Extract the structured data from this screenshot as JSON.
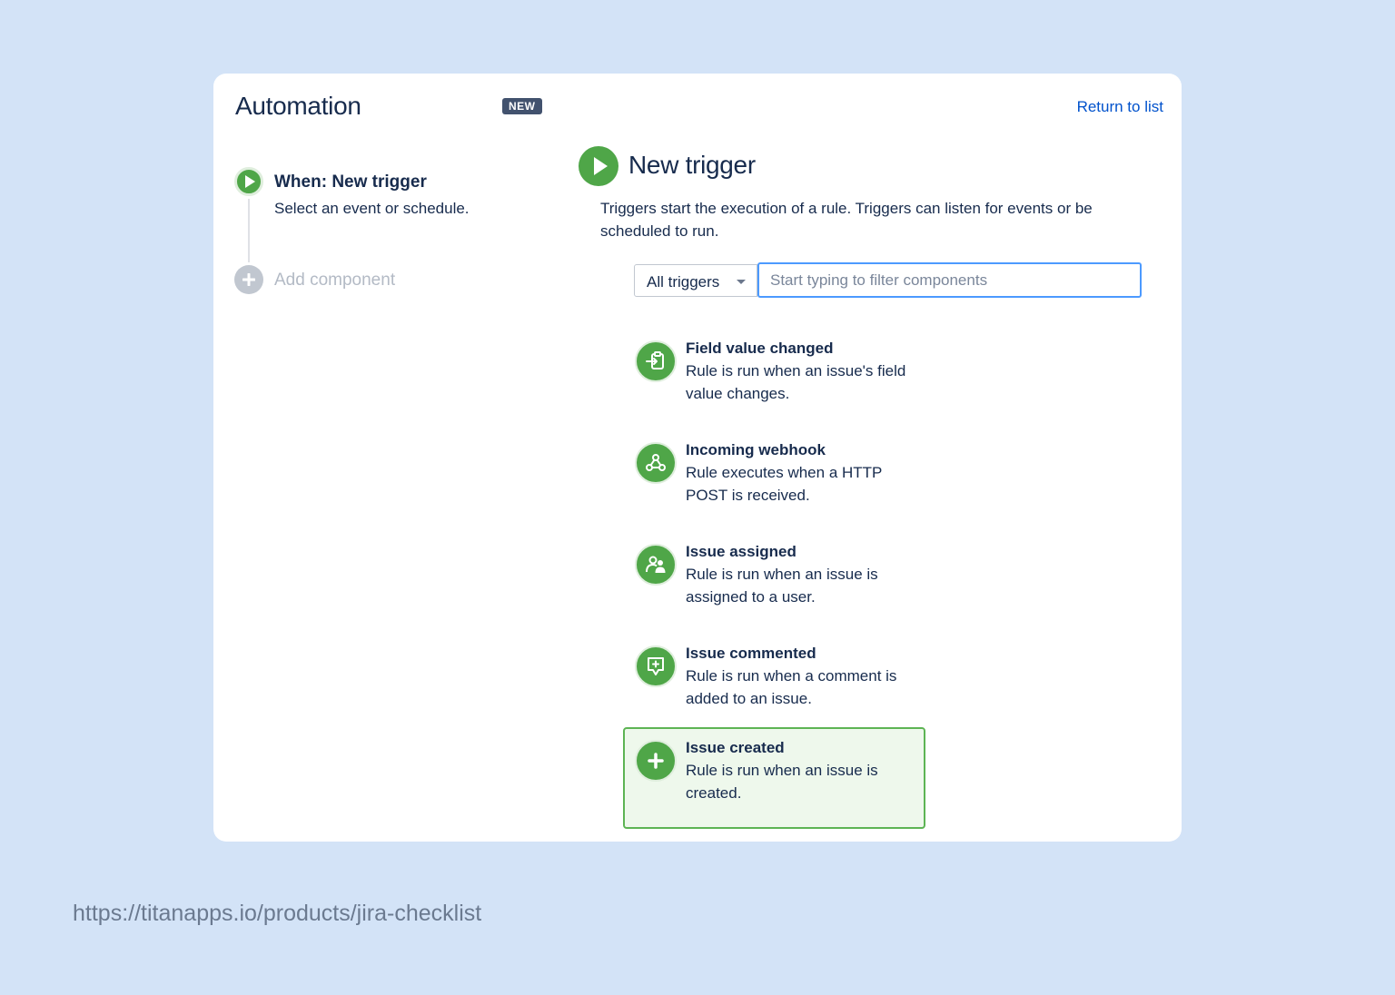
{
  "header": {
    "title": "Automation",
    "badge": "NEW",
    "return_link": "Return to list"
  },
  "rule_steps": {
    "when_title": "When: New trigger",
    "when_subtitle": "Select an event or schedule.",
    "add_component": "Add component"
  },
  "panel": {
    "title": "New trigger",
    "description": "Triggers start the execution of a rule. Triggers can listen for events or be scheduled to run."
  },
  "filter": {
    "select_value": "All triggers",
    "input_placeholder": "Start typing to filter components",
    "input_value": ""
  },
  "triggers": [
    {
      "title": "Field value changed",
      "description": "Rule is run when an issue's field value changes.",
      "icon": "field-change-icon",
      "selected": false
    },
    {
      "title": "Incoming webhook",
      "description": "Rule executes when a HTTP POST is received.",
      "icon": "webhook-icon",
      "selected": false
    },
    {
      "title": "Issue assigned",
      "description": "Rule is run when an issue is assigned to a user.",
      "icon": "user-assign-icon",
      "selected": false
    },
    {
      "title": "Issue commented",
      "description": "Rule is run when a comment is added to an issue.",
      "icon": "comment-add-icon",
      "selected": false
    },
    {
      "title": "Issue created",
      "description": "Rule is run when an issue is created.",
      "icon": "plus-icon",
      "selected": true
    }
  ],
  "footer": {
    "url": "https://titanapps.io/products/jira-checklist"
  },
  "colors": {
    "background": "#d3e3f7",
    "accent_green": "#4fa648",
    "selected_bg": "#eef8ec",
    "link_blue": "#0052cc",
    "badge_bg": "#42526e"
  }
}
